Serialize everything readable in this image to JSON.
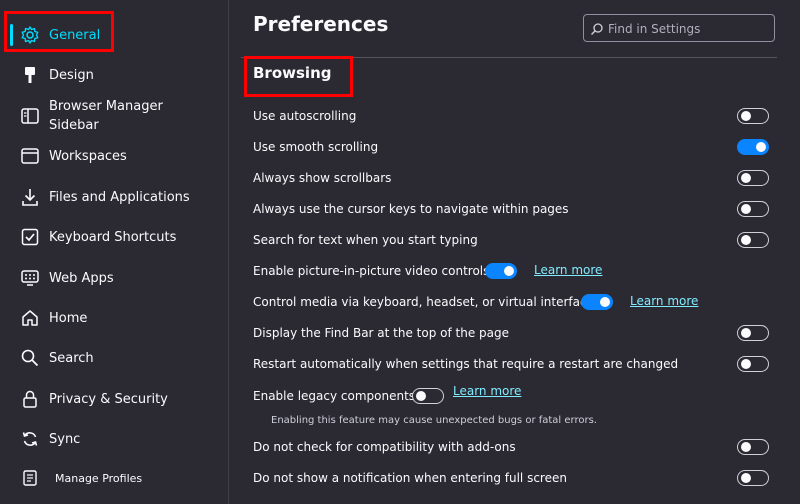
{
  "sidebar": {
    "items": [
      {
        "label": "General",
        "icon": "gear-icon"
      },
      {
        "label": "Design",
        "icon": "brush-icon"
      },
      {
        "label": "Browser Manager\nSidebar",
        "icon": "sidebar-icon"
      },
      {
        "label": "Workspaces",
        "icon": "workspaces-icon"
      },
      {
        "label": "Files and Applications",
        "icon": "download-icon"
      },
      {
        "label": "Keyboard Shortcuts",
        "icon": "keyboard-check-icon"
      },
      {
        "label": "Web Apps",
        "icon": "webapps-icon"
      },
      {
        "label": "Home",
        "icon": "home-icon"
      },
      {
        "label": "Search",
        "icon": "search-icon"
      },
      {
        "label": "Privacy & Security",
        "icon": "lock-icon"
      },
      {
        "label": "Sync",
        "icon": "sync-icon"
      }
    ],
    "manage_profiles": "Manage Profiles"
  },
  "header": {
    "title": "Preferences",
    "search_placeholder": "Find in Settings"
  },
  "section": {
    "title": "Browsing"
  },
  "settings": [
    {
      "label": "Use autoscrolling",
      "checked": false
    },
    {
      "label": "Use smooth scrolling",
      "checked": true
    },
    {
      "label": "Always show scrollbars",
      "checked": false
    },
    {
      "label": "Always use the cursor keys to navigate within pages",
      "checked": false
    },
    {
      "label": "Search for text when you start typing",
      "checked": false
    },
    {
      "label": "Enable picture-in-picture video controls",
      "checked": true,
      "link": "Learn more"
    },
    {
      "label": "Control media via keyboard, headset, or virtual interface",
      "checked": true,
      "link": "Learn more"
    },
    {
      "label": "Display the Find Bar at the top of the page",
      "checked": false
    },
    {
      "label": "Restart automatically when settings that require a restart are changed",
      "checked": false
    },
    {
      "label": "Enable legacy components",
      "checked": false,
      "link": "Learn more",
      "note": "Enabling this feature may cause unexpected bugs or fatal errors."
    },
    {
      "label": "Do not check for compatibility with add-ons",
      "checked": false
    },
    {
      "label": "Do not show a notification when entering full screen",
      "checked": false
    }
  ],
  "colors": {
    "accent": "#00ddff",
    "toggle_on": "#0a84ff",
    "highlight": "#ff0000",
    "link": "#80ebff"
  }
}
